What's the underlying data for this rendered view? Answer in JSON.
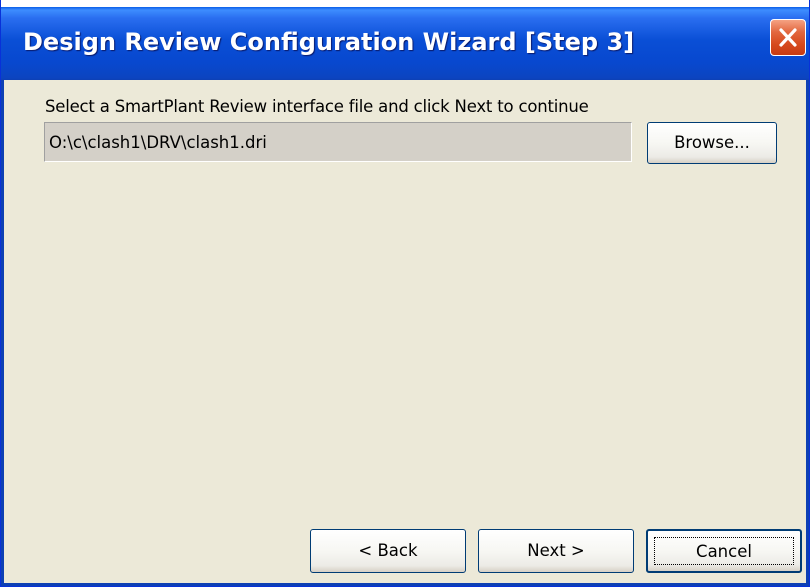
{
  "window": {
    "title": "Design Review Configuration Wizard [Step 3]"
  },
  "content": {
    "prompt": "Select a SmartPlant Review interface file and click Next to continue",
    "file_path": "O:\\c\\clash1\\DRV\\clash1.dri"
  },
  "buttons": {
    "browse": "Browse...",
    "back": "< Back",
    "next": "Next >",
    "cancel": "Cancel"
  },
  "icons": {
    "close": "close-x-icon"
  },
  "colors": {
    "titlebar_blue": "#0a4fd6",
    "window_bg": "#ece9d8",
    "close_red": "#d6491d",
    "button_border": "#003c74"
  }
}
